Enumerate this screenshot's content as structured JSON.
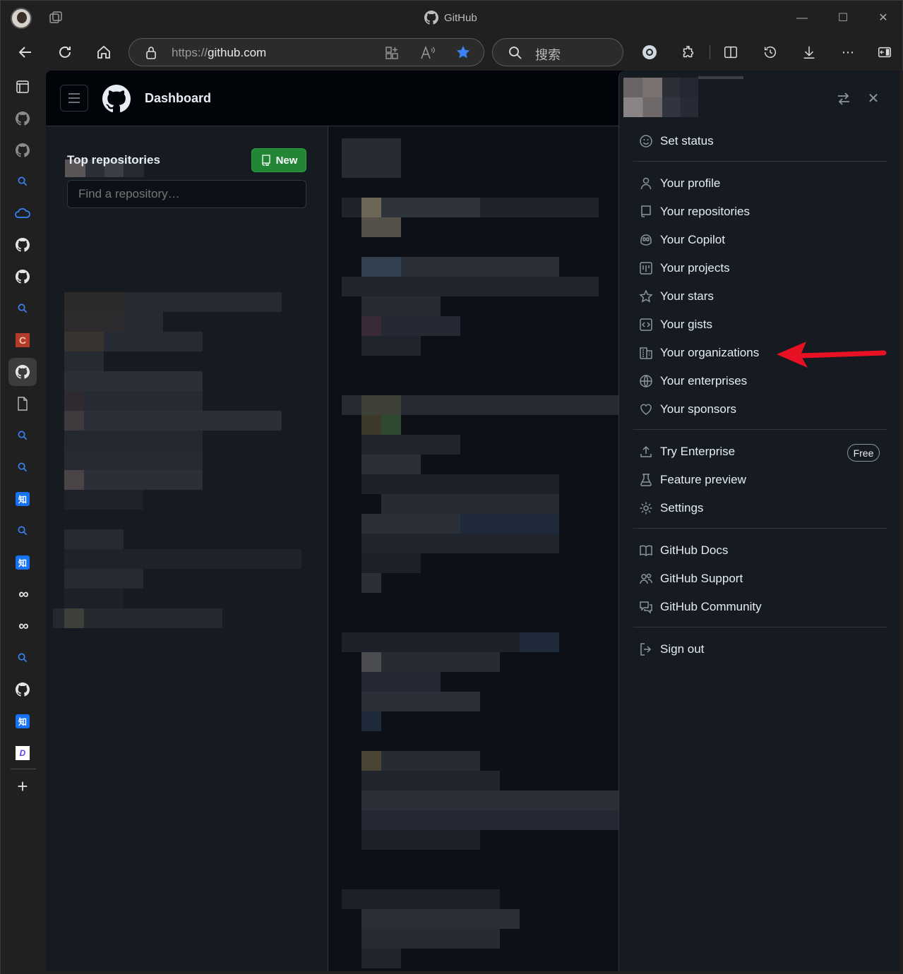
{
  "browser": {
    "tab_title": "GitHub",
    "url_prefix": "https://",
    "url_host": "github.com",
    "search_placeholder": "搜索"
  },
  "sidebar": {
    "items": [
      {
        "name": "tab-actions-icon"
      },
      {
        "name": "github-favicon"
      },
      {
        "name": "github-favicon"
      },
      {
        "name": "search-favicon"
      },
      {
        "name": "cloud-favicon"
      },
      {
        "name": "github-favicon"
      },
      {
        "name": "github-favicon"
      },
      {
        "name": "search-favicon"
      },
      {
        "name": "c-favicon",
        "text": "C"
      },
      {
        "name": "github-favicon"
      },
      {
        "name": "document-favicon"
      },
      {
        "name": "search-favicon"
      },
      {
        "name": "search-favicon"
      },
      {
        "name": "zhihu-favicon",
        "text": "知"
      },
      {
        "name": "search-favicon"
      },
      {
        "name": "zhihu-favicon",
        "text": "知"
      },
      {
        "name": "infinity-favicon",
        "text": "∞"
      },
      {
        "name": "infinity-favicon",
        "text": "∞"
      },
      {
        "name": "search-favicon"
      },
      {
        "name": "github-favicon"
      },
      {
        "name": "zhihu-favicon",
        "text": "知"
      },
      {
        "name": "d-favicon",
        "text": "D"
      }
    ],
    "add_label": "+"
  },
  "header": {
    "title": "Dashboard"
  },
  "left": {
    "top_repositories": "Top repositories",
    "new_button": "New",
    "find_placeholder": "Find a repository…"
  },
  "menu": {
    "set_status": "Set status",
    "group1": [
      "Your profile",
      "Your repositories",
      "Your Copilot",
      "Your projects",
      "Your stars",
      "Your gists",
      "Your organizations",
      "Your enterprises",
      "Your sponsors"
    ],
    "group2": [
      "Try Enterprise",
      "Feature preview",
      "Settings"
    ],
    "free_badge": "Free",
    "group3": [
      "GitHub Docs",
      "GitHub Support",
      "GitHub Community"
    ],
    "sign_out": "Sign out"
  },
  "colors": {
    "accent_green": "#238636",
    "arrow_red": "#e81123",
    "star_blue": "#3b82f6"
  }
}
